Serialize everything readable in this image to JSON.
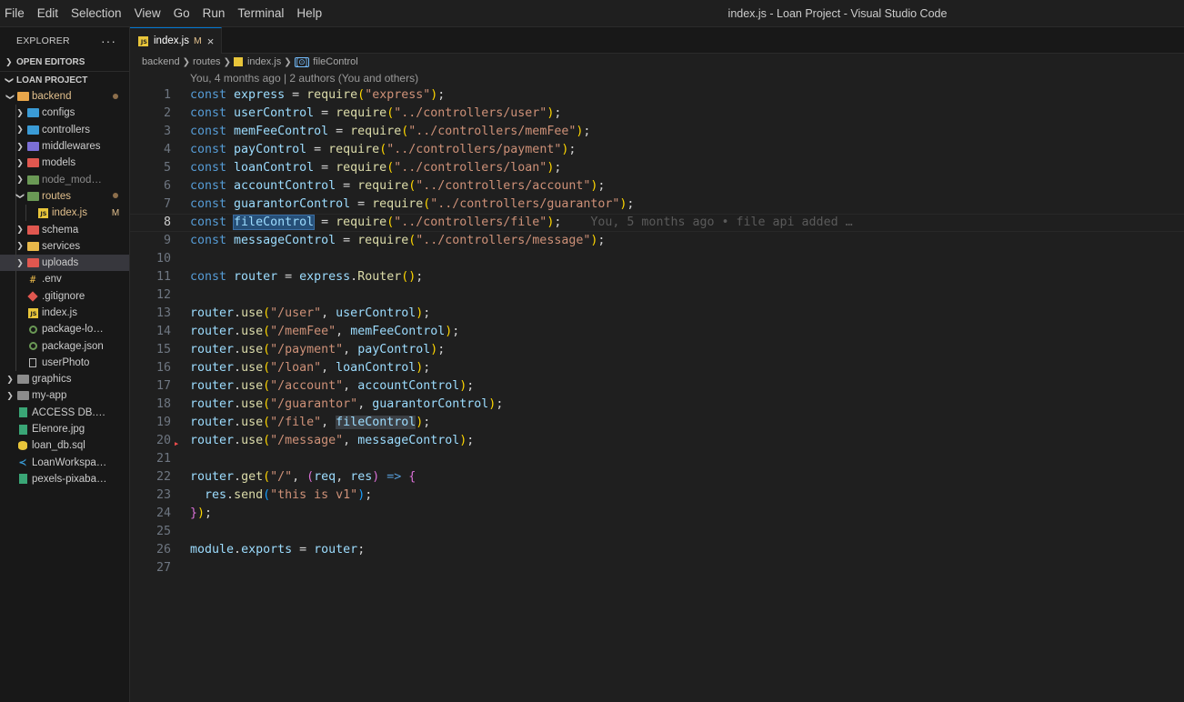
{
  "window": {
    "title": "index.js - Loan Project - Visual Studio Code",
    "menu": [
      "File",
      "Edit",
      "Selection",
      "View",
      "Go",
      "Run",
      "Terminal",
      "Help"
    ]
  },
  "explorer": {
    "title": "EXPLORER",
    "more": "···",
    "open_editors": "OPEN EDITORS",
    "project": "LOAN PROJECT",
    "items": [
      {
        "label": "backend",
        "kind": "folder",
        "depth": 0,
        "expanded": true,
        "decoration": "dot",
        "color": "#e2c08d",
        "icon": "folder-open-icon"
      },
      {
        "label": "configs",
        "kind": "folder",
        "depth": 1,
        "expanded": false,
        "icon": "folder-config-icon"
      },
      {
        "label": "controllers",
        "kind": "folder",
        "depth": 1,
        "expanded": false,
        "icon": "folder-controllers-icon"
      },
      {
        "label": "middlewares",
        "kind": "folder",
        "depth": 1,
        "expanded": false,
        "icon": "folder-middleware-icon"
      },
      {
        "label": "models",
        "kind": "folder",
        "depth": 1,
        "expanded": false,
        "icon": "folder-models-icon"
      },
      {
        "label": "node_modules",
        "kind": "folder",
        "depth": 1,
        "expanded": false,
        "color": "#8c8c8c",
        "icon": "folder-node-icon"
      },
      {
        "label": "routes",
        "kind": "folder",
        "depth": 1,
        "expanded": true,
        "decoration": "dot",
        "color": "#e2c08d",
        "icon": "folder-routes-icon"
      },
      {
        "label": "index.js",
        "kind": "file",
        "depth": 2,
        "decoration": "M",
        "color": "#e2c08d",
        "icon": "javascript-file-icon"
      },
      {
        "label": "schema",
        "kind": "folder",
        "depth": 1,
        "expanded": false,
        "icon": "folder-schema-icon"
      },
      {
        "label": "services",
        "kind": "folder",
        "depth": 1,
        "expanded": false,
        "icon": "folder-services-icon"
      },
      {
        "label": "uploads",
        "kind": "folder",
        "depth": 1,
        "expanded": false,
        "selected": true,
        "icon": "folder-upload-icon"
      },
      {
        "label": ".env",
        "kind": "file",
        "depth": 1,
        "icon": "env-file-icon"
      },
      {
        "label": ".gitignore",
        "kind": "file",
        "depth": 1,
        "icon": "git-file-icon"
      },
      {
        "label": "index.js",
        "kind": "file",
        "depth": 1,
        "icon": "javascript-file-icon"
      },
      {
        "label": "package-lock.json",
        "kind": "file",
        "depth": 1,
        "icon": "npm-file-icon"
      },
      {
        "label": "package.json",
        "kind": "file",
        "depth": 1,
        "icon": "npm-file-icon"
      },
      {
        "label": "userPhoto",
        "kind": "file",
        "depth": 1,
        "icon": "blank-file-icon"
      },
      {
        "label": "graphics",
        "kind": "folder",
        "depth": 0,
        "expanded": false,
        "icon": "folder-icon"
      },
      {
        "label": "my-app",
        "kind": "folder",
        "depth": 0,
        "expanded": false,
        "icon": "folder-icon"
      },
      {
        "label": "ACCESS DB.JPG",
        "kind": "file",
        "depth": 0,
        "icon": "image-file-icon"
      },
      {
        "label": "Elenore.jpg",
        "kind": "file",
        "depth": 0,
        "icon": "image-file-icon"
      },
      {
        "label": "loan_db.sql",
        "kind": "file",
        "depth": 0,
        "icon": "database-file-icon"
      },
      {
        "label": "LoanWorkspace.c...",
        "kind": "file",
        "depth": 0,
        "icon": "vscode-workspace-icon"
      },
      {
        "label": "pexels-pixabay-2...",
        "kind": "file",
        "depth": 0,
        "icon": "image-file-icon"
      }
    ]
  },
  "tab": {
    "label": "index.js",
    "modified": "M",
    "close": "×"
  },
  "breadcrumb": [
    "backend",
    "routes",
    "index.js",
    "fileControl"
  ],
  "codelens": "You, 4 months ago | 2 authors (You and others)",
  "blame": "You, 5 months ago • file api added …",
  "current_line": 8,
  "colors": {
    "accent": "#0078d4",
    "modified": "#e2c08d",
    "error_marker": "#f14c4c"
  },
  "code_lines": [
    [
      [
        "k",
        "const "
      ],
      [
        "v",
        "express"
      ],
      [
        "op",
        " = "
      ],
      [
        "f",
        "require"
      ],
      [
        "p1",
        "("
      ],
      [
        "s",
        "\"express\""
      ],
      [
        "p1",
        ")"
      ],
      [
        "op",
        ";"
      ]
    ],
    [
      [
        "k",
        "const "
      ],
      [
        "v",
        "userControl"
      ],
      [
        "op",
        " = "
      ],
      [
        "f",
        "require"
      ],
      [
        "p1",
        "("
      ],
      [
        "s",
        "\"../controllers/user\""
      ],
      [
        "p1",
        ")"
      ],
      [
        "op",
        ";"
      ]
    ],
    [
      [
        "k",
        "const "
      ],
      [
        "v",
        "memFeeControl"
      ],
      [
        "op",
        " = "
      ],
      [
        "f",
        "require"
      ],
      [
        "p1",
        "("
      ],
      [
        "s",
        "\"../controllers/memFee\""
      ],
      [
        "p1",
        ")"
      ],
      [
        "op",
        ";"
      ]
    ],
    [
      [
        "k",
        "const "
      ],
      [
        "v",
        "payControl"
      ],
      [
        "op",
        " = "
      ],
      [
        "f",
        "require"
      ],
      [
        "p1",
        "("
      ],
      [
        "s",
        "\"../controllers/payment\""
      ],
      [
        "p1",
        ")"
      ],
      [
        "op",
        ";"
      ]
    ],
    [
      [
        "k",
        "const "
      ],
      [
        "v",
        "loanControl"
      ],
      [
        "op",
        " = "
      ],
      [
        "f",
        "require"
      ],
      [
        "p1",
        "("
      ],
      [
        "s",
        "\"../controllers/loan\""
      ],
      [
        "p1",
        ")"
      ],
      [
        "op",
        ";"
      ]
    ],
    [
      [
        "k",
        "const "
      ],
      [
        "v",
        "accountControl"
      ],
      [
        "op",
        " = "
      ],
      [
        "f",
        "require"
      ],
      [
        "p1",
        "("
      ],
      [
        "s",
        "\"../controllers/account\""
      ],
      [
        "p1",
        ")"
      ],
      [
        "op",
        ";"
      ]
    ],
    [
      [
        "k",
        "const "
      ],
      [
        "v",
        "guarantorControl"
      ],
      [
        "op",
        " = "
      ],
      [
        "f",
        "require"
      ],
      [
        "p1",
        "("
      ],
      [
        "s",
        "\"../controllers/guarantor\""
      ],
      [
        "p1",
        ")"
      ],
      [
        "op",
        ";"
      ]
    ],
    [
      [
        "k",
        "const "
      ],
      [
        "v sel",
        "fileControl"
      ],
      [
        "op",
        " = "
      ],
      [
        "f",
        "require"
      ],
      [
        "p1",
        "("
      ],
      [
        "s",
        "\"../controllers/file\""
      ],
      [
        "p1",
        ")"
      ],
      [
        "op",
        ";"
      ],
      [
        "blame",
        "    "
      ],
      [
        "blame",
        "BLAME"
      ]
    ],
    [
      [
        "k",
        "const "
      ],
      [
        "v",
        "messageControl"
      ],
      [
        "op",
        " = "
      ],
      [
        "f",
        "require"
      ],
      [
        "p1",
        "("
      ],
      [
        "s",
        "\"../controllers/message\""
      ],
      [
        "p1",
        ")"
      ],
      [
        "op",
        ";"
      ]
    ],
    [],
    [
      [
        "k",
        "const "
      ],
      [
        "v",
        "router"
      ],
      [
        "op",
        " = "
      ],
      [
        "v",
        "express"
      ],
      [
        "op",
        "."
      ],
      [
        "f",
        "Router"
      ],
      [
        "p1",
        "()"
      ],
      [
        "op",
        ";"
      ]
    ],
    [],
    [
      [
        "v",
        "router"
      ],
      [
        "op",
        "."
      ],
      [
        "f",
        "use"
      ],
      [
        "p1",
        "("
      ],
      [
        "s",
        "\"/user\""
      ],
      [
        "op",
        ", "
      ],
      [
        "v",
        "userControl"
      ],
      [
        "p1",
        ")"
      ],
      [
        "op",
        ";"
      ]
    ],
    [
      [
        "v",
        "router"
      ],
      [
        "op",
        "."
      ],
      [
        "f",
        "use"
      ],
      [
        "p1",
        "("
      ],
      [
        "s",
        "\"/memFee\""
      ],
      [
        "op",
        ", "
      ],
      [
        "v",
        "memFeeControl"
      ],
      [
        "p1",
        ")"
      ],
      [
        "op",
        ";"
      ]
    ],
    [
      [
        "v",
        "router"
      ],
      [
        "op",
        "."
      ],
      [
        "f",
        "use"
      ],
      [
        "p1",
        "("
      ],
      [
        "s",
        "\"/payment\""
      ],
      [
        "op",
        ", "
      ],
      [
        "v",
        "payControl"
      ],
      [
        "p1",
        ")"
      ],
      [
        "op",
        ";"
      ]
    ],
    [
      [
        "v",
        "router"
      ],
      [
        "op",
        "."
      ],
      [
        "f",
        "use"
      ],
      [
        "p1",
        "("
      ],
      [
        "s",
        "\"/loan\""
      ],
      [
        "op",
        ", "
      ],
      [
        "v",
        "loanControl"
      ],
      [
        "p1",
        ")"
      ],
      [
        "op",
        ";"
      ]
    ],
    [
      [
        "v",
        "router"
      ],
      [
        "op",
        "."
      ],
      [
        "f",
        "use"
      ],
      [
        "p1",
        "("
      ],
      [
        "s",
        "\"/account\""
      ],
      [
        "op",
        ", "
      ],
      [
        "v",
        "accountControl"
      ],
      [
        "p1",
        ")"
      ],
      [
        "op",
        ";"
      ]
    ],
    [
      [
        "v",
        "router"
      ],
      [
        "op",
        "."
      ],
      [
        "f",
        "use"
      ],
      [
        "p1",
        "("
      ],
      [
        "s",
        "\"/guarantor\""
      ],
      [
        "op",
        ", "
      ],
      [
        "v",
        "guarantorControl"
      ],
      [
        "p1",
        ")"
      ],
      [
        "op",
        ";"
      ]
    ],
    [
      [
        "v",
        "router"
      ],
      [
        "op",
        "."
      ],
      [
        "f",
        "use"
      ],
      [
        "p1",
        "("
      ],
      [
        "s",
        "\"/file\""
      ],
      [
        "op",
        ", "
      ],
      [
        "v hl",
        "fileControl"
      ],
      [
        "p1",
        ")"
      ],
      [
        "op",
        ";"
      ]
    ],
    [
      [
        "v",
        "router"
      ],
      [
        "op",
        "."
      ],
      [
        "f",
        "use"
      ],
      [
        "p1",
        "("
      ],
      [
        "s",
        "\"/message\""
      ],
      [
        "op",
        ", "
      ],
      [
        "v",
        "messageControl"
      ],
      [
        "p1",
        ")"
      ],
      [
        "op",
        ";"
      ]
    ],
    [],
    [
      [
        "v",
        "router"
      ],
      [
        "op",
        "."
      ],
      [
        "f",
        "get"
      ],
      [
        "p1",
        "("
      ],
      [
        "s",
        "\"/\""
      ],
      [
        "op",
        ", "
      ],
      [
        "p2",
        "("
      ],
      [
        "v",
        "req"
      ],
      [
        "op",
        ", "
      ],
      [
        "v",
        "res"
      ],
      [
        "p2",
        ")"
      ],
      [
        "k",
        " => "
      ],
      [
        "p2",
        "{"
      ]
    ],
    [
      [
        "op",
        "  "
      ],
      [
        "v",
        "res"
      ],
      [
        "op",
        "."
      ],
      [
        "f",
        "send"
      ],
      [
        "p3",
        "("
      ],
      [
        "s",
        "\"this is v1\""
      ],
      [
        "p3",
        ")"
      ],
      [
        "op",
        ";"
      ]
    ],
    [
      [
        "p2",
        "}"
      ],
      [
        "p1",
        ")"
      ],
      [
        "op",
        ";"
      ]
    ],
    [],
    [
      [
        "v",
        "module"
      ],
      [
        "op",
        "."
      ],
      [
        "v",
        "exports"
      ],
      [
        "op",
        " = "
      ],
      [
        "v",
        "router"
      ],
      [
        "op",
        ";"
      ]
    ],
    []
  ],
  "gutter_marker_line": 20
}
